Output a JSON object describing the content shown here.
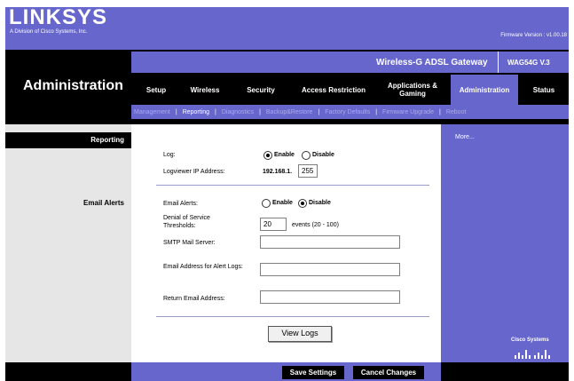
{
  "header": {
    "logo": "LINKSYS",
    "logo_sub": "A Division of Cisco Systems, Inc.",
    "firmware": "Firmware Version : v1.00.18",
    "product_name": "Wireless-G ADSL Gateway",
    "model": "WAG54G V.3",
    "section_title": "Administration"
  },
  "tabs": [
    {
      "label": "Setup"
    },
    {
      "label": "Wireless"
    },
    {
      "label": "Security"
    },
    {
      "label": "Access Restriction"
    },
    {
      "label": "Applications & Gaming"
    },
    {
      "label": "Administration"
    },
    {
      "label": "Status"
    }
  ],
  "subnav": [
    "Management",
    "Reporting",
    "Diagnostics",
    "Backup&Restore",
    "Factory Defaults",
    "Firmware Upgrade",
    "Reboot"
  ],
  "subnav_separator": "|",
  "left": {
    "reporting": "Reporting",
    "email_alerts": "Email Alerts"
  },
  "form": {
    "log_label": "Log:",
    "enable": "Enable",
    "disable": "Disable",
    "log_selected": "Enable",
    "logviewer_label": "Logviewer IP Address:",
    "ip_prefix": "192.168.1.",
    "ip_last": "255",
    "email_alerts_label": "Email Alerts:",
    "email_alerts_selected": "Disable",
    "dos_label": "Denial of Service Thresholds:",
    "dos_value": "20",
    "dos_unit": "events (20 - 100)",
    "smtp_label": "SMTP Mail Server:",
    "smtp_value": "",
    "alert_email_label": "Email Address for Alert Logs:",
    "alert_email_value": "",
    "return_email_label": "Return Email Address:",
    "return_email_value": "",
    "view_logs": "View Logs"
  },
  "right": {
    "more": "More...",
    "cisco": "Cisco Systems"
  },
  "footer": {
    "save": "Save Settings",
    "cancel": "Cancel Changes"
  }
}
